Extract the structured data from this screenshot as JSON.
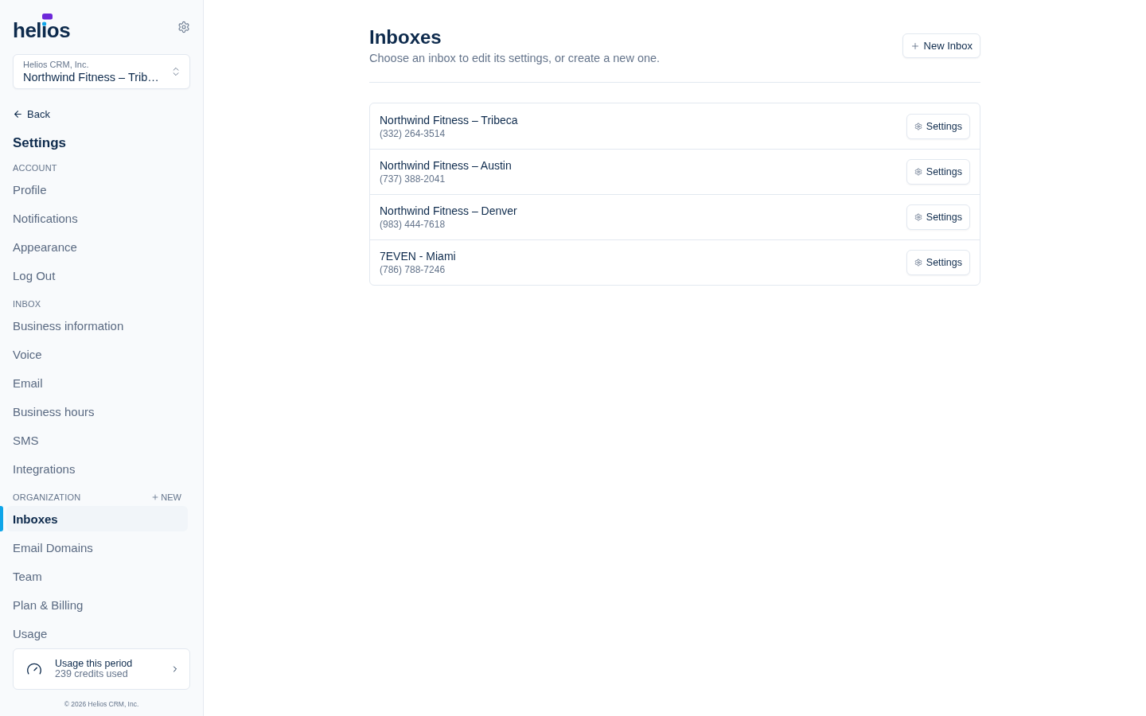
{
  "sidebar": {
    "logo": "helios",
    "workspace": {
      "org": "Helios CRM, Inc.",
      "inbox": "Northwind Fitness – Trib…"
    },
    "back": "Back",
    "title": "Settings",
    "sections": [
      {
        "heading": "ACCOUNT",
        "items": [
          {
            "label": "Profile",
            "selected": false
          },
          {
            "label": "Notifications",
            "selected": false
          },
          {
            "label": "Appearance",
            "selected": false
          },
          {
            "label": "Log Out",
            "selected": false
          }
        ]
      },
      {
        "heading": "INBOX",
        "items": [
          {
            "label": "Business information",
            "selected": false
          },
          {
            "label": "Voice",
            "selected": false
          },
          {
            "label": "Email",
            "selected": false
          },
          {
            "label": "Business hours",
            "selected": false
          },
          {
            "label": "SMS",
            "selected": false
          },
          {
            "label": "Integrations",
            "selected": false
          }
        ]
      },
      {
        "heading": "ORGANIZATION",
        "action": "NEW",
        "items": [
          {
            "label": "Inboxes",
            "selected": true
          },
          {
            "label": "Email Domains",
            "selected": false
          },
          {
            "label": "Team",
            "selected": false
          },
          {
            "label": "Plan & Billing",
            "selected": false
          },
          {
            "label": "Usage",
            "selected": false
          }
        ]
      }
    ],
    "usage": {
      "title": "Usage this period",
      "detail": "239 credits used"
    },
    "footer": "© 2026 Helios CRM, Inc."
  },
  "main": {
    "title": "Inboxes",
    "subtitle": "Choose an inbox to edit its settings, or create a new one.",
    "button": "New Inbox",
    "inboxes": [
      {
        "name": "Northwind Fitness – Tribeca",
        "phone": "(332) 264-3514",
        "button": "Settings"
      },
      {
        "name": "Northwind Fitness – Austin",
        "phone": "(737) 388-2041",
        "button": "Settings"
      },
      {
        "name": "Northwind Fitness – Denver",
        "phone": "(983) 444-7618",
        "button": "Settings"
      },
      {
        "name": "7EVEN - Miami",
        "phone": "(786) 788-7246",
        "button": "Settings"
      }
    ]
  }
}
